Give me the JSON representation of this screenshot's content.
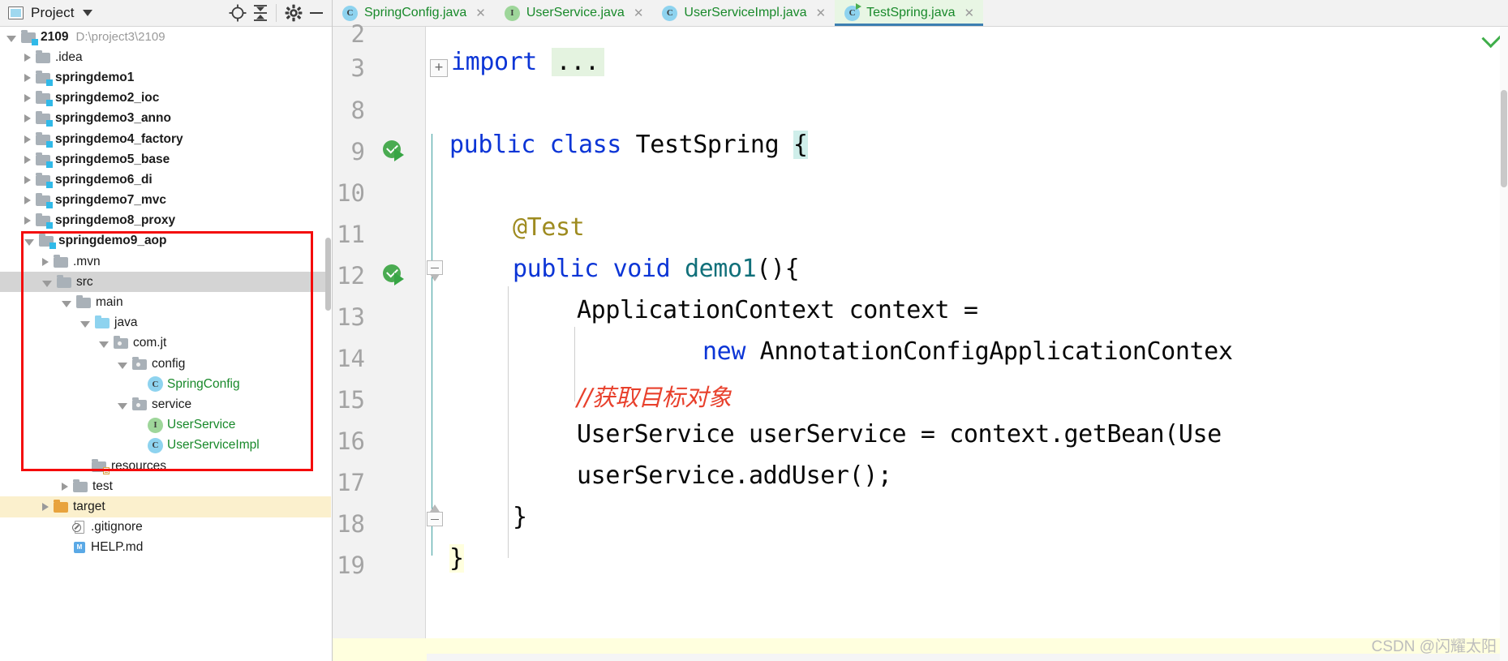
{
  "sidebar": {
    "header": {
      "title": "Project",
      "icons": [
        "project-view-icon",
        "chevron-down-icon",
        "locate-icon",
        "collapse-all-icon",
        "settings-icon",
        "hide-icon"
      ]
    },
    "tree": [
      {
        "label": "2109",
        "path": "D:\\project3\\2109",
        "depth": 0,
        "state": "open",
        "icon": "module-folder",
        "bold": true
      },
      {
        "label": ".idea",
        "depth": 1,
        "state": "closed",
        "icon": "folder",
        "bold": false
      },
      {
        "label": "springdemo1",
        "depth": 1,
        "state": "closed",
        "icon": "module-folder",
        "bold": true
      },
      {
        "label": "springdemo2_ioc",
        "depth": 1,
        "state": "closed",
        "icon": "module-folder",
        "bold": true
      },
      {
        "label": "springdemo3_anno",
        "depth": 1,
        "state": "closed",
        "icon": "module-folder",
        "bold": true
      },
      {
        "label": "springdemo4_factory",
        "depth": 1,
        "state": "closed",
        "icon": "module-folder",
        "bold": true
      },
      {
        "label": "springdemo5_base",
        "depth": 1,
        "state": "closed",
        "icon": "module-folder",
        "bold": true
      },
      {
        "label": "springdemo6_di",
        "depth": 1,
        "state": "closed",
        "icon": "module-folder",
        "bold": true
      },
      {
        "label": "springdemo7_mvc",
        "depth": 1,
        "state": "closed",
        "icon": "module-folder",
        "bold": true
      },
      {
        "label": "springdemo8_proxy",
        "depth": 1,
        "state": "closed",
        "icon": "module-folder",
        "bold": true
      },
      {
        "label": "springdemo9_aop",
        "depth": 1,
        "state": "open",
        "icon": "module-folder",
        "bold": true
      },
      {
        "label": ".mvn",
        "depth": 2,
        "state": "closed",
        "icon": "folder",
        "bold": false
      },
      {
        "label": "src",
        "depth": 2,
        "state": "open",
        "icon": "folder",
        "bold": false,
        "selected": true
      },
      {
        "label": "main",
        "depth": 3,
        "state": "open",
        "icon": "folder",
        "bold": false
      },
      {
        "label": "java",
        "depth": 4,
        "state": "open",
        "icon": "source-folder",
        "bold": false
      },
      {
        "label": "com.jt",
        "depth": 5,
        "state": "open",
        "icon": "package-folder",
        "bold": false
      },
      {
        "label": "config",
        "depth": 6,
        "state": "open",
        "icon": "package-folder",
        "bold": false
      },
      {
        "label": "SpringConfig",
        "depth": 7,
        "state": "leaf",
        "icon": "class-icon",
        "vcs": "green"
      },
      {
        "label": "service",
        "depth": 6,
        "state": "open",
        "icon": "package-folder",
        "bold": false
      },
      {
        "label": "UserService",
        "depth": 7,
        "state": "leaf",
        "icon": "interface-icon",
        "vcs": "green"
      },
      {
        "label": "UserServiceImpl",
        "depth": 7,
        "state": "leaf",
        "icon": "class-icon",
        "vcs": "green"
      },
      {
        "label": "resources",
        "depth": 4,
        "state": "leaf",
        "icon": "resource-folder",
        "bold": false
      },
      {
        "label": "test",
        "depth": 3,
        "state": "closed",
        "icon": "folder",
        "bold": false
      },
      {
        "label": "target",
        "depth": 2,
        "state": "closed",
        "icon": "target-folder",
        "bold": false
      },
      {
        "label": ".gitignore",
        "depth": 3,
        "state": "leaf",
        "icon": "gitignore-icon",
        "bold": false
      },
      {
        "label": "HELP.md",
        "depth": 3,
        "state": "leaf",
        "icon": "markdown-icon",
        "bold": false
      }
    ]
  },
  "editor": {
    "tabs": [
      {
        "label": "SpringConfig.java",
        "icon": "class-icon",
        "active": false
      },
      {
        "label": "UserService.java",
        "icon": "interface-icon",
        "active": false
      },
      {
        "label": "UserServiceImpl.java",
        "icon": "class-icon",
        "active": false
      },
      {
        "label": "TestSpring.java",
        "icon": "runnable-class-icon",
        "active": true
      }
    ],
    "close_glyph": "✕",
    "line_numbers": [
      "2",
      "3",
      "8",
      "9",
      "10",
      "11",
      "12",
      "13",
      "14",
      "15",
      "16",
      "17",
      "18",
      "19"
    ],
    "code": {
      "l3_keyword": "import",
      "l3_folded": "...",
      "l9_a": "public class",
      "l9_b": " TestSpring ",
      "l9_c": "{",
      "l11": "@Test",
      "l12_a": "public void ",
      "l12_b": "demo1",
      "l12_c": "(){",
      "l13": "ApplicationContext context =",
      "l14_a": "new",
      "l14_b": " AnnotationConfigApplicationContex",
      "l15": "//获取目标对象",
      "l16": "UserService userService = context.getBean(Use",
      "l17": "userService.addUser();",
      "l18": "}",
      "l19": "}"
    }
  },
  "watermark": "CSDN @闪耀太阳",
  "colors": {
    "accent_blue": "#0c35d6",
    "vcs_green": "#18892a",
    "comment_red": "#e8402c",
    "annotation_olive": "#9e8b20",
    "method_teal": "#11707a",
    "highlight_box": "#f40c0c",
    "active_tab_bg": "#e8f6e4",
    "selection_grey": "#d4d4d4"
  }
}
